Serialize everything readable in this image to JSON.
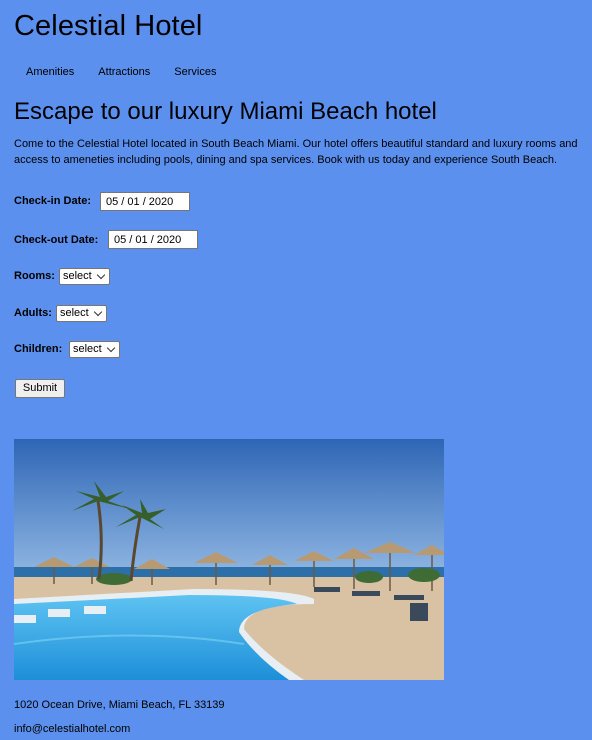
{
  "header": {
    "title": "Celestial Hotel"
  },
  "nav": {
    "items": [
      "Amenities",
      "Attractions",
      "Services"
    ]
  },
  "main": {
    "headline": "Escape to our luxury Miami Beach hotel",
    "intro": "Come to the Celestial Hotel located in South Beach Miami. Our hotel offers beautiful standard and luxury rooms and access to ameneties including pools, dining and spa services. Book with us today and experience South Beach."
  },
  "form": {
    "checkin_label": "Check-in Date:",
    "checkin_value": "05 / 01 / 2020",
    "checkout_label": "Check-out Date:",
    "checkout_value": "05 / 01 / 2020",
    "rooms_label": "Rooms:",
    "rooms_value": "select",
    "adults_label": "Adults:",
    "adults_value": "select",
    "children_label": "Children:",
    "children_value": "select",
    "submit_label": "Submit"
  },
  "footer": {
    "address": "1020 Ocean Drive, Miami Beach, FL 33139",
    "email": "info@celestialhotel.com"
  }
}
